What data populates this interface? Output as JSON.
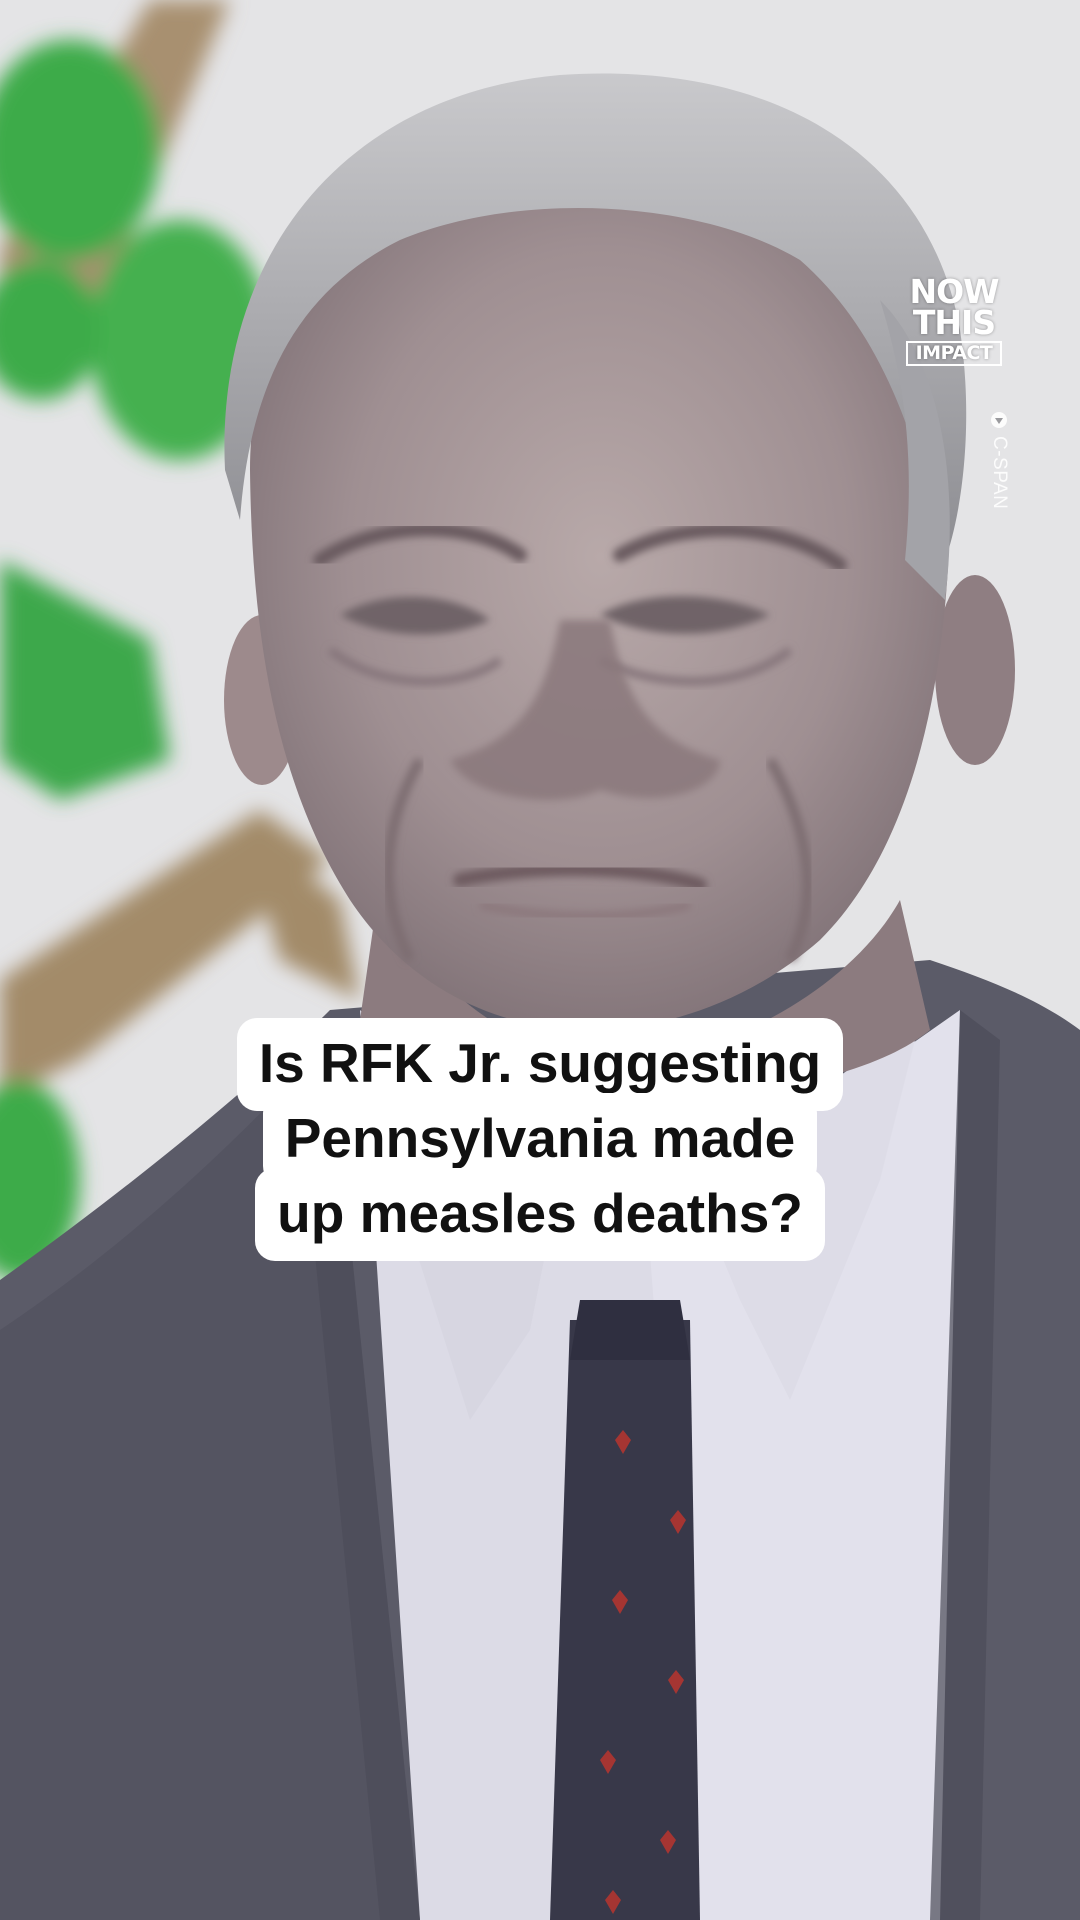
{
  "video": {
    "caption_lines": [
      "Is RFK Jr. suggesting",
      "Pennsylvania made",
      "up measles deaths?"
    ],
    "logo": {
      "line1": "NOW",
      "line2": "THIS",
      "line3": "IMPACT"
    },
    "source_credit": "C-SPAN",
    "colors": {
      "caption_bg": "#ffffff",
      "caption_text": "#111111",
      "suit": "#5a5a66",
      "tie": "#3a3a4a",
      "tie_pattern": "#b8352e",
      "wall_green": "#3cab4a",
      "wall_brown": "#a08a68"
    }
  }
}
